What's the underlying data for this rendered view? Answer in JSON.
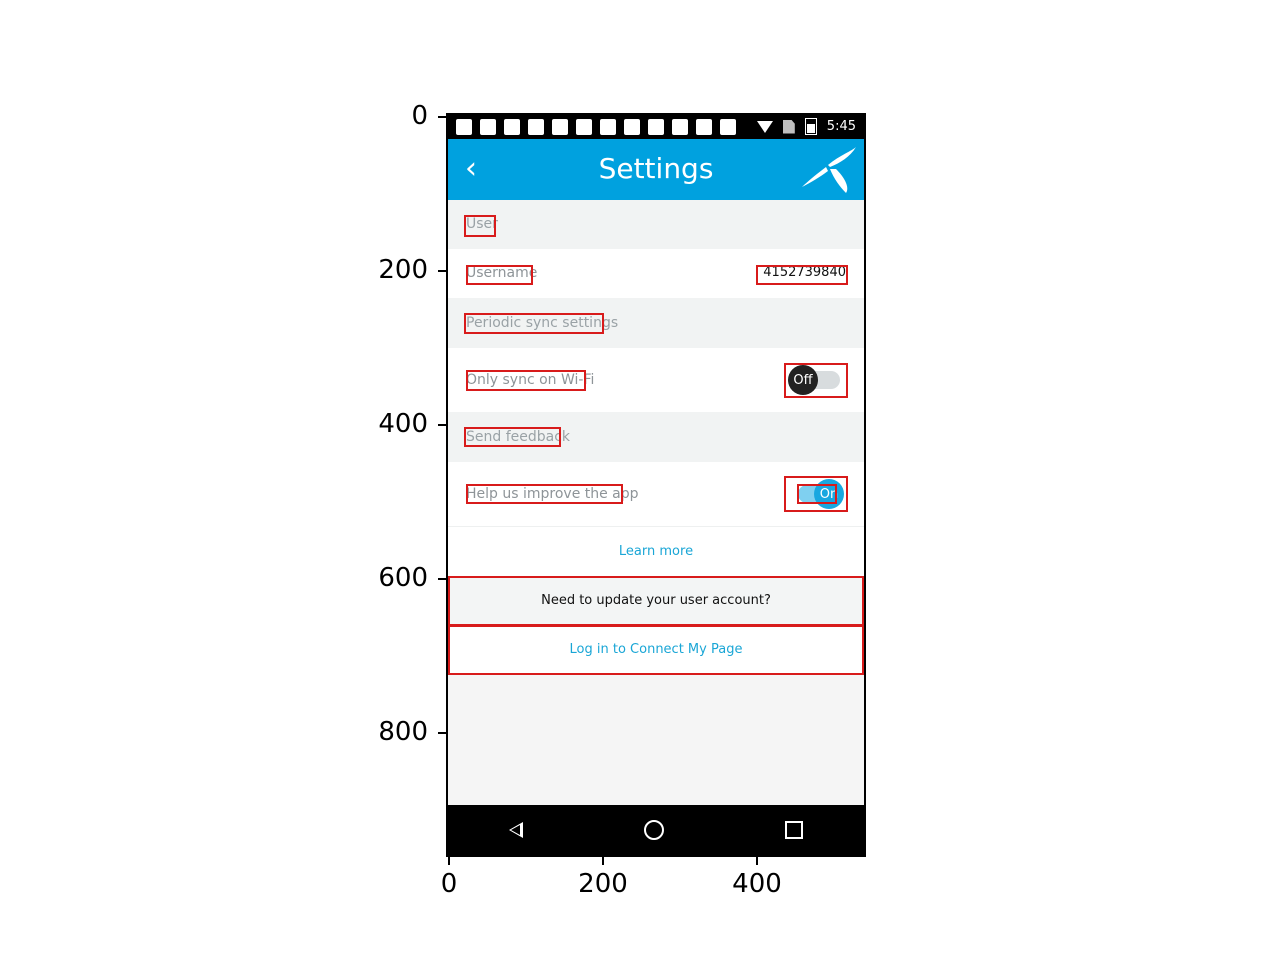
{
  "axes": {
    "y_ticks": [
      "0",
      "200",
      "400",
      "600",
      "800"
    ],
    "x_ticks": [
      "0",
      "200",
      "400"
    ]
  },
  "status_bar": {
    "time": "5:45",
    "icons": [
      "message-icon",
      "facebook-icon",
      "facebook-icon",
      "facebook-icon",
      "facebook-icon",
      "facebook-icon",
      "facebook-icon",
      "facebook-icon",
      "facebook-icon",
      "facebook-icon",
      "facebook-icon",
      "gmail-icon",
      "wifi-icon",
      "no-sim-icon",
      "battery-icon"
    ]
  },
  "app_bar": {
    "title": "Settings",
    "back_icon": "chevron-left-icon",
    "logo": "telenor-logo",
    "back_glyph": "‹",
    "colors": {
      "accent": "#00a1df"
    }
  },
  "sections": {
    "user": {
      "header": "User",
      "username_label": "Username",
      "username_value": "4152739840"
    },
    "sync": {
      "header": "Periodic sync settings",
      "wifi_label": "Only sync on Wi-Fi",
      "wifi_toggle": "Off"
    },
    "feedback": {
      "header": "Send feedback",
      "improve_label": "Help us improve the app",
      "improve_toggle": "On",
      "learn_more": "Learn more"
    }
  },
  "account": {
    "question": "Need to update your user account?",
    "login_link": "Log in to Connect My Page"
  },
  "nav_bar": {
    "icons": [
      "back-triangle-icon",
      "home-circle-icon",
      "recents-square-icon"
    ]
  }
}
